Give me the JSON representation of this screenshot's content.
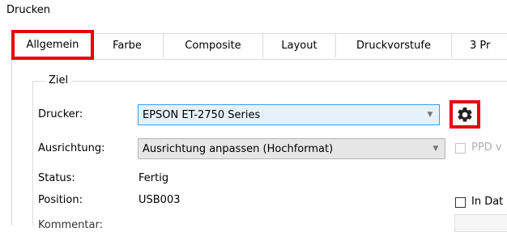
{
  "window": {
    "title": "Drucken"
  },
  "tabs": [
    {
      "label": "Allgemein",
      "active": true
    },
    {
      "label": "Farbe"
    },
    {
      "label": "Composite"
    },
    {
      "label": "Layout"
    },
    {
      "label": "Druckvorstufe"
    },
    {
      "label": "3 Pr"
    }
  ],
  "group": {
    "legend": "Ziel"
  },
  "printer": {
    "label": "Drucker:",
    "value": "EPSON ET-2750 Series"
  },
  "orientation": {
    "label": "Ausrichtung:",
    "value": "Ausrichtung anpassen (Hochformat)"
  },
  "ppd": {
    "label": "PPD v",
    "checked": false,
    "enabled": false
  },
  "status": {
    "label": "Status:",
    "value": "Fertig"
  },
  "position": {
    "label": "Position:",
    "value": "USB003"
  },
  "in_file": {
    "label": "In Dat",
    "checked": false
  },
  "comment": {
    "label": "Kommentar:"
  },
  "icons": {
    "settings": "gear-icon",
    "dropdown": "chevron-down-icon"
  },
  "colors": {
    "highlight": "#e8000b",
    "focus_border": "#3d99e6",
    "focus_fill": "#e5f1fb"
  }
}
